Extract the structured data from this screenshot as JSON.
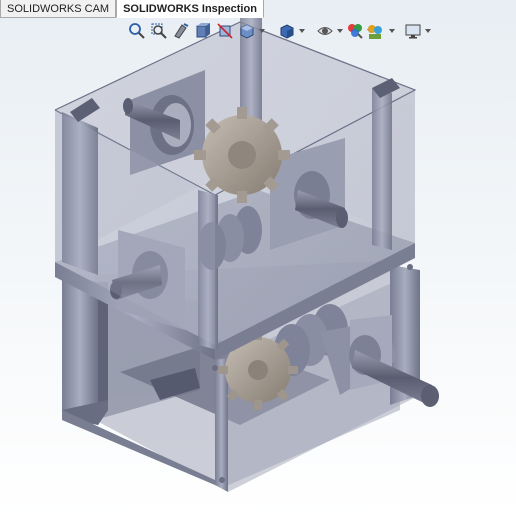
{
  "tabs": [
    {
      "label": "SOLIDWORKS CAM",
      "active": false
    },
    {
      "label": "SOLIDWORKS Inspection",
      "active": true
    }
  ],
  "hud_toolbar": {
    "icons": [
      "zoom-to-fit-icon",
      "zoom-to-area-icon",
      "previous-view-icon",
      "section-view-icon",
      "dynamic-annotation-views-icon",
      "view-orientation-icon",
      "display-style-icon",
      "hide-show-items-icon",
      "edit-appearance-icon",
      "apply-scene-icon",
      "view-settings-icon"
    ]
  },
  "colors": {
    "housing_glass": "#b4b9c8",
    "frame_metal": "#8c90a6",
    "gear": "#a8a19a",
    "shaft": "#6a6d80",
    "viewport_top": "#e8eef3"
  },
  "model": {
    "description_type": "3d-cad-assembly"
  }
}
